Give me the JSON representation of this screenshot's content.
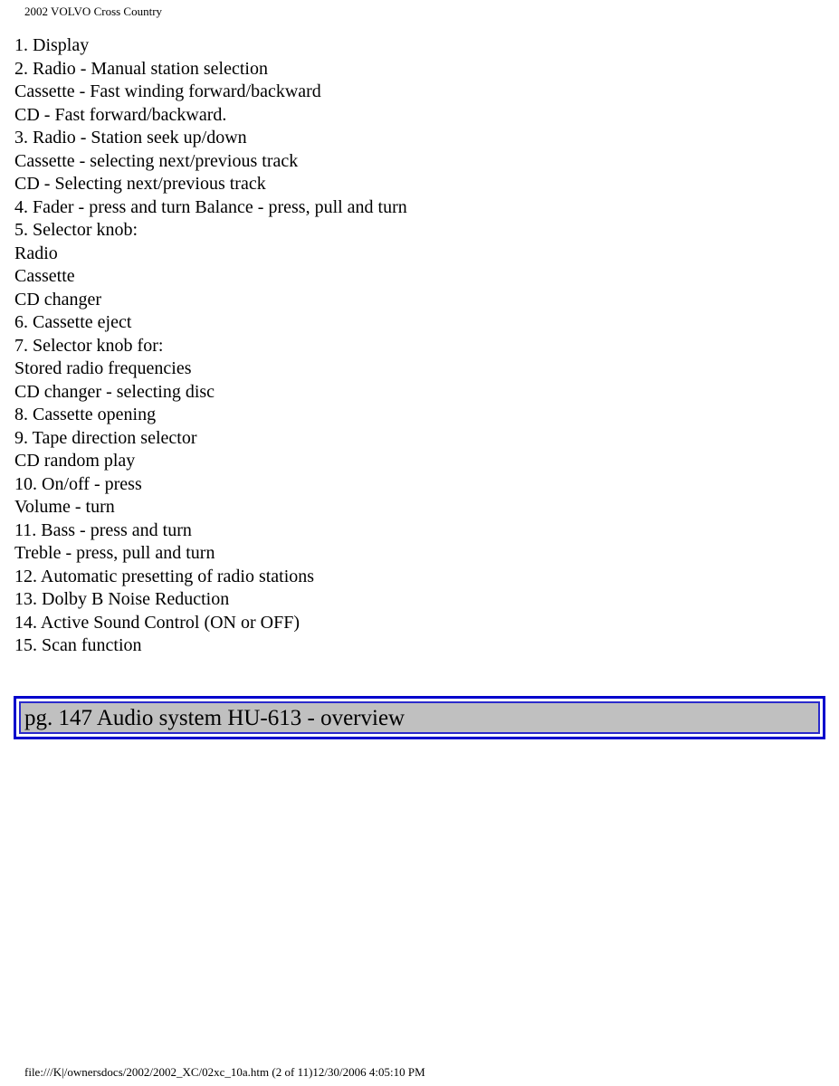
{
  "header": {
    "title": "2002 VOLVO Cross Country"
  },
  "content": {
    "lines": [
      "1. Display",
      "2. Radio - Manual station selection",
      "Cassette - Fast winding forward/backward",
      "CD - Fast forward/backward.",
      "3. Radio - Station seek up/down",
      "Cassette - selecting next/previous track",
      "CD - Selecting next/previous track",
      "4. Fader - press and turn Balance - press, pull and turn",
      "5. Selector knob:",
      "Radio",
      "Cassette",
      "CD changer",
      "6. Cassette eject",
      "7. Selector knob for:",
      "Stored radio frequencies",
      "CD changer - selecting disc",
      "8. Cassette opening",
      "9. Tape direction selector",
      "CD random play",
      "10. On/off - press",
      "Volume - turn",
      "11. Bass - press and turn",
      "Treble - press, pull and turn",
      "12. Automatic presetting of radio stations",
      "13. Dolby B Noise Reduction",
      "14. Active Sound Control (ON or OFF)",
      "15. Scan function"
    ]
  },
  "nav": {
    "label": "pg. 147 Audio system HU-613 - overview",
    "border_color": "#0000cc",
    "background_color": "#c0c0c0"
  },
  "footer": {
    "text": "file:///K|/ownersdocs/2002/2002_XC/02xc_10a.htm (2 of 11)12/30/2006 4:05:10 PM"
  }
}
